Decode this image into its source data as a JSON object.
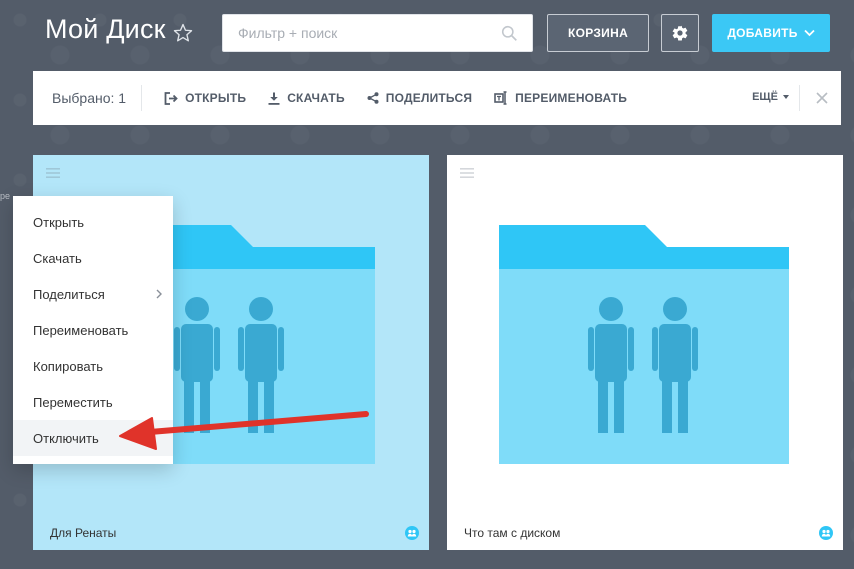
{
  "header": {
    "title": "Мой Диск",
    "search_placeholder": "Фильтр + поиск",
    "trash_label": "КОРЗИНА",
    "add_label": "ДОБАВИТЬ"
  },
  "actionbar": {
    "selected": "Выбрано: 1",
    "actions": [
      {
        "label": "ОТКРЫТЬ",
        "icon": "open-icon"
      },
      {
        "label": "СКАЧАТЬ",
        "icon": "download-icon"
      },
      {
        "label": "ПОДЕЛИТЬСЯ",
        "icon": "share-icon"
      },
      {
        "label": "ПЕРЕИМЕНОВАТЬ",
        "icon": "rename-icon"
      }
    ],
    "more_label": "ЕЩЁ"
  },
  "context_menu": {
    "items": [
      {
        "label": "Открыть"
      },
      {
        "label": "Скачать"
      },
      {
        "label": "Поделиться",
        "has_submenu": true
      },
      {
        "label": "Переименовать"
      },
      {
        "label": "Копировать"
      },
      {
        "label": "Переместить"
      },
      {
        "label": "Отключить",
        "highlighted": true
      }
    ]
  },
  "cards": [
    {
      "name": "Для Ренаты",
      "selected": true,
      "shared": true
    },
    {
      "name": "Что там с диском",
      "selected": false,
      "shared": true
    }
  ],
  "colors": {
    "background": "#535c69",
    "accent": "#3bc8f5",
    "folder_tab": "#2fc6f6",
    "folder_body": "#7fdcf9",
    "people": "#3aa9d2",
    "arrow": "#e0332a"
  }
}
